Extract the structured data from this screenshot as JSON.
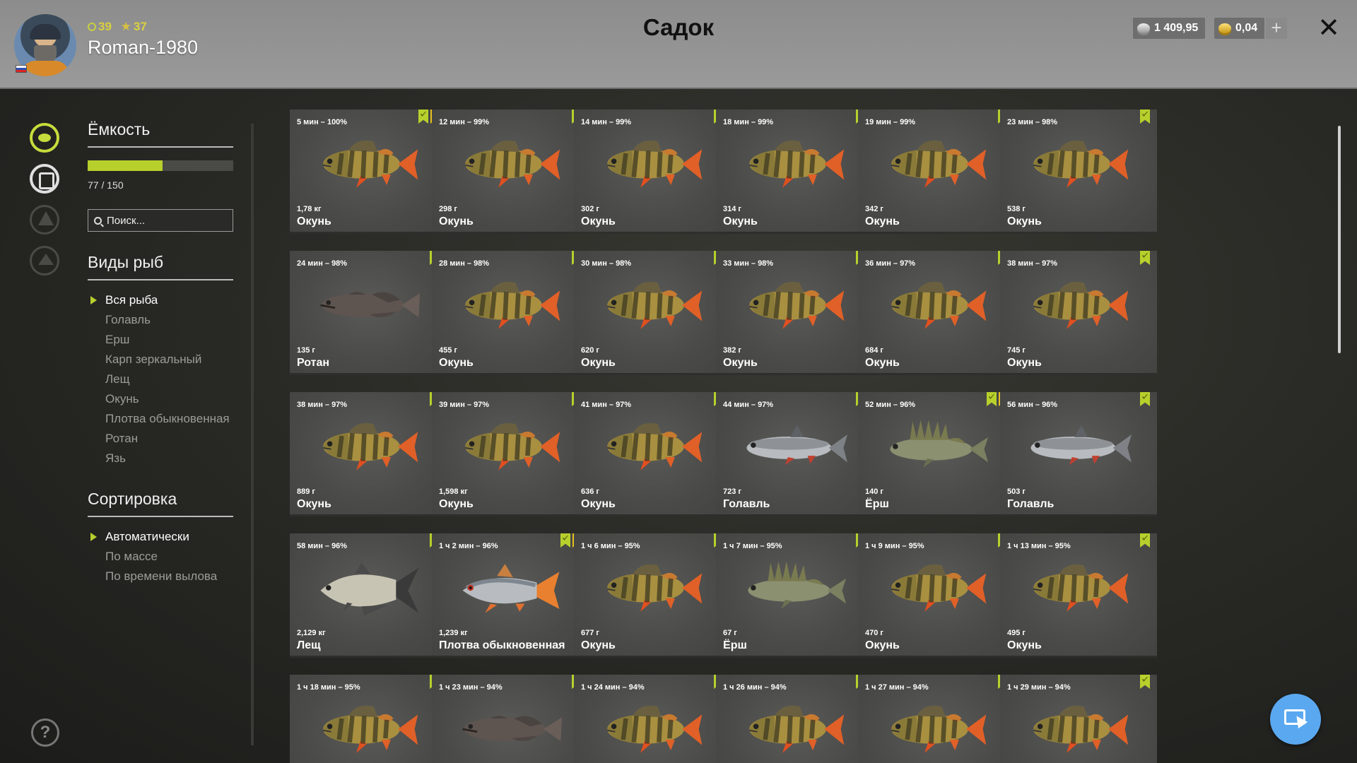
{
  "header": {
    "title": "Садок",
    "username": "Roman-1980",
    "level": "39",
    "stars": "37",
    "currency_silver": "1 409,95",
    "currency_gold": "0,04",
    "plus_label": "+",
    "close_label": "✕"
  },
  "panel": {
    "capacity_title": "Ёмкость",
    "capacity_text": "77 / 150",
    "capacity_fraction": 0.513,
    "search_placeholder": "Поиск...",
    "species_title": "Виды рыб",
    "species": [
      "Вся рыба",
      "Голавль",
      "Ерш",
      "Карп зеркальный",
      "Лещ",
      "Окунь",
      "Плотва обыкновенная",
      "Ротан",
      "Язь"
    ],
    "sort_title": "Сортировка",
    "sort_options": [
      "Автоматически",
      "По массе",
      "По времени вылова"
    ],
    "help_label": "?"
  },
  "colors": {
    "accent": "#b8d02c",
    "star_badge": "#e8c020",
    "perch_body": "#a89040",
    "fin_red": "#e05020"
  },
  "catches": [
    {
      "time": "5 мин – 100%",
      "weight": "1,78 кг",
      "name": "Окунь",
      "fish": "perch-icon",
      "star": true
    },
    {
      "time": "12 мин – 99%",
      "weight": "298 г",
      "name": "Окунь",
      "fish": "perch-icon",
      "star": false
    },
    {
      "time": "14 мин – 99%",
      "weight": "302 г",
      "name": "Окунь",
      "fish": "perch-icon",
      "star": false
    },
    {
      "time": "18 мин – 99%",
      "weight": "314 г",
      "name": "Окунь",
      "fish": "perch-icon",
      "star": false
    },
    {
      "time": "19 мин – 99%",
      "weight": "342 г",
      "name": "Окунь",
      "fish": "perch-icon",
      "star": false
    },
    {
      "time": "23 мин – 98%",
      "weight": "538 г",
      "name": "Окунь",
      "fish": "perch-icon",
      "star": false
    },
    {
      "time": "24 мин – 98%",
      "weight": "135 г",
      "name": "Ротан",
      "fish": "rotan-icon",
      "star": false
    },
    {
      "time": "28 мин – 98%",
      "weight": "455 г",
      "name": "Окунь",
      "fish": "perch-icon",
      "star": false
    },
    {
      "time": "30 мин – 98%",
      "weight": "620 г",
      "name": "Окунь",
      "fish": "perch-icon",
      "star": false
    },
    {
      "time": "33 мин – 98%",
      "weight": "382 г",
      "name": "Окунь",
      "fish": "perch-icon",
      "star": false
    },
    {
      "time": "36 мин – 97%",
      "weight": "684 г",
      "name": "Окунь",
      "fish": "perch-icon",
      "star": false
    },
    {
      "time": "38 мин – 97%",
      "weight": "745 г",
      "name": "Окунь",
      "fish": "perch-icon",
      "star": false
    },
    {
      "time": "38 мин – 97%",
      "weight": "889 г",
      "name": "Окунь",
      "fish": "perch-icon",
      "star": false
    },
    {
      "time": "39 мин – 97%",
      "weight": "1,598 кг",
      "name": "Окунь",
      "fish": "perch-icon",
      "star": false
    },
    {
      "time": "41 мин – 97%",
      "weight": "636 г",
      "name": "Окунь",
      "fish": "perch-icon",
      "star": false
    },
    {
      "time": "44 мин – 97%",
      "weight": "723 г",
      "name": "Голавль",
      "fish": "chub-icon",
      "star": false
    },
    {
      "time": "52 мин – 96%",
      "weight": "140 г",
      "name": "Ёрш",
      "fish": "ruffe-icon",
      "star": true
    },
    {
      "time": "56 мин – 96%",
      "weight": "503 г",
      "name": "Голавль",
      "fish": "chub-icon",
      "star": false
    },
    {
      "time": "58 мин – 96%",
      "weight": "2,129 кг",
      "name": "Лещ",
      "fish": "bream-icon",
      "star": false
    },
    {
      "time": "1 ч 2 мин – 96%",
      "weight": "1,239 кг",
      "name": "Плотва обыкновенная",
      "fish": "roach-icon",
      "star": true
    },
    {
      "time": "1 ч 6 мин – 95%",
      "weight": "677 г",
      "name": "Окунь",
      "fish": "perch-icon",
      "star": false
    },
    {
      "time": "1 ч 7 мин – 95%",
      "weight": "67 г",
      "name": "Ёрш",
      "fish": "ruffe-icon",
      "star": false
    },
    {
      "time": "1 ч 9 мин – 95%",
      "weight": "470 г",
      "name": "Окунь",
      "fish": "perch-icon",
      "star": false
    },
    {
      "time": "1 ч 13 мин – 95%",
      "weight": "495 г",
      "name": "Окунь",
      "fish": "perch-icon",
      "star": false
    },
    {
      "time": "1 ч 18 мин – 95%",
      "weight": "",
      "name": "",
      "fish": "perch-icon",
      "star": false
    },
    {
      "time": "1 ч 23 мин – 94%",
      "weight": "",
      "name": "",
      "fish": "rotan-icon",
      "star": false
    },
    {
      "time": "1 ч 24 мин – 94%",
      "weight": "",
      "name": "",
      "fish": "perch-icon",
      "star": false
    },
    {
      "time": "1 ч 26 мин – 94%",
      "weight": "",
      "name": "",
      "fish": "perch-icon",
      "star": false
    },
    {
      "time": "1 ч 27 мин – 94%",
      "weight": "",
      "name": "",
      "fish": "perch-icon",
      "star": false
    },
    {
      "time": "1 ч 29 мин – 94%",
      "weight": "",
      "name": "",
      "fish": "perch-icon",
      "star": false
    }
  ]
}
